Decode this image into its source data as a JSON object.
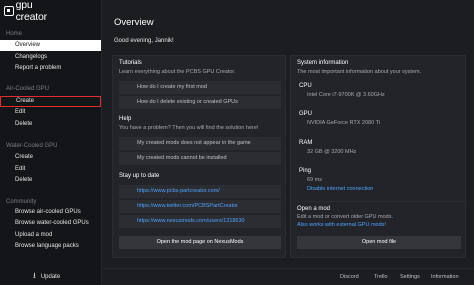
{
  "app": {
    "logo_text": "gpu creator"
  },
  "sidebar": {
    "sections": [
      {
        "title": "Home",
        "items": [
          {
            "label": "Overview"
          },
          {
            "label": "Changelogs"
          },
          {
            "label": "Report a problem"
          }
        ]
      },
      {
        "title": "Air-Cooled GPU",
        "items": [
          {
            "label": "Create"
          },
          {
            "label": "Edit"
          },
          {
            "label": "Delete"
          }
        ]
      },
      {
        "title": "Water-Cooled GPU",
        "items": [
          {
            "label": "Create"
          },
          {
            "label": "Edit"
          },
          {
            "label": "Delete"
          }
        ]
      },
      {
        "title": "Community",
        "items": [
          {
            "label": "Browse air-cooled GPUs"
          },
          {
            "label": "Browse water-cooled GPUs"
          },
          {
            "label": "Upload a mod"
          },
          {
            "label": "Browse language packs"
          }
        ]
      }
    ],
    "update_label": "Update"
  },
  "main": {
    "title": "Overview",
    "greeting": "Good evening, Jannik!",
    "tutorials": {
      "title": "Tutorials",
      "subtitle": "Learn everything about the PCBS GPU Creator.",
      "items": [
        "How do I create my first mod",
        "How do I delete existing or created GPUs"
      ]
    },
    "help": {
      "title": "Help",
      "subtitle": "You have a problem? Then you will find the solution here!",
      "items": [
        "My created mods does not appear in the game",
        "My created mods cannot be installed"
      ]
    },
    "stay_up": {
      "title": "Stay up to date",
      "links": [
        "https://www.pcbs-partcreator.com/",
        "https://www.twitter.com/PCBSPartCreator",
        "https://www.nexusmods.com/users/1318630"
      ],
      "button": "Open the mod page on NexusMods"
    },
    "system_info": {
      "title": "System information",
      "subtitle": "The most important information about your system.",
      "cpu_label": "CPU",
      "cpu_value": "Intel Core i7-9700K @ 3.60GHz",
      "gpu_label": "GPU",
      "gpu_value": "NVIDIA GeForce RTX 2080 Ti",
      "ram_label": "RAM",
      "ram_value": "32 GB @ 3200 MHz",
      "ping_label": "Ping",
      "ping_value": "69 ms",
      "ping_link": "Disable internet connection"
    },
    "open_mod": {
      "title": "Open a mod",
      "subtitle": "Edit a mod or convert older GPU mods.",
      "link": "Also works with external GPU mods!",
      "button": "Open mod file"
    }
  },
  "footer": {
    "links": [
      "Discord",
      "Trello",
      "Settings",
      "Information"
    ]
  },
  "colors": {
    "accent_link": "#4fa3ff",
    "highlight_border": "#e02d2d",
    "active_item_bg": "#ffffff"
  }
}
